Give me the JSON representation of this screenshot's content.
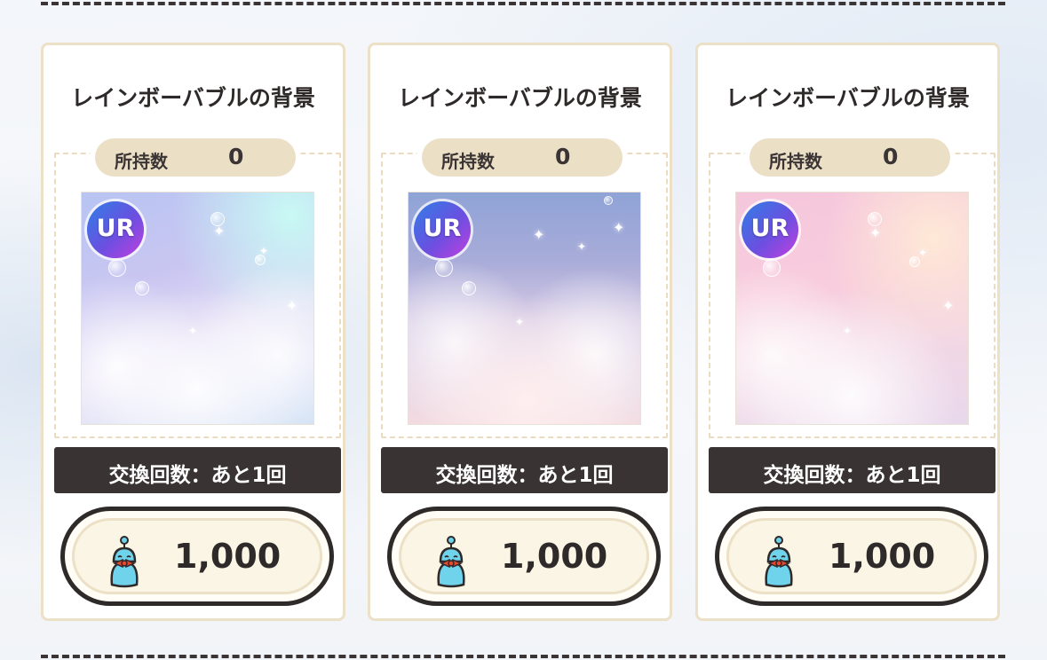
{
  "cards": [
    {
      "title": "レインボーバブルの背景",
      "owned_label": "所持数",
      "owned_count": "0",
      "rarity_badge": "UR",
      "exchange_label": "交換回数：あと1回",
      "price": "1,000",
      "currency_icon": "mascot-currency-icon"
    },
    {
      "title": "レインボーバブルの背景",
      "owned_label": "所持数",
      "owned_count": "0",
      "rarity_badge": "UR",
      "exchange_label": "交換回数：あと1回",
      "price": "1,000",
      "currency_icon": "mascot-currency-icon"
    },
    {
      "title": "レインボーバブルの背景",
      "owned_label": "所持数",
      "owned_count": "0",
      "rarity_badge": "UR",
      "exchange_label": "交換回数：あと1回",
      "price": "1,000",
      "currency_icon": "mascot-currency-icon"
    }
  ],
  "colors": {
    "card_border": "#ece0c6",
    "dark_text": "#2f2a2a",
    "exchange_bar": "#393334",
    "badge_gradient_start": "#2f7fe6",
    "badge_gradient_end": "#c33fe0",
    "mascot_body": "#6fd3ec",
    "mascot_bow": "#e8462d"
  }
}
